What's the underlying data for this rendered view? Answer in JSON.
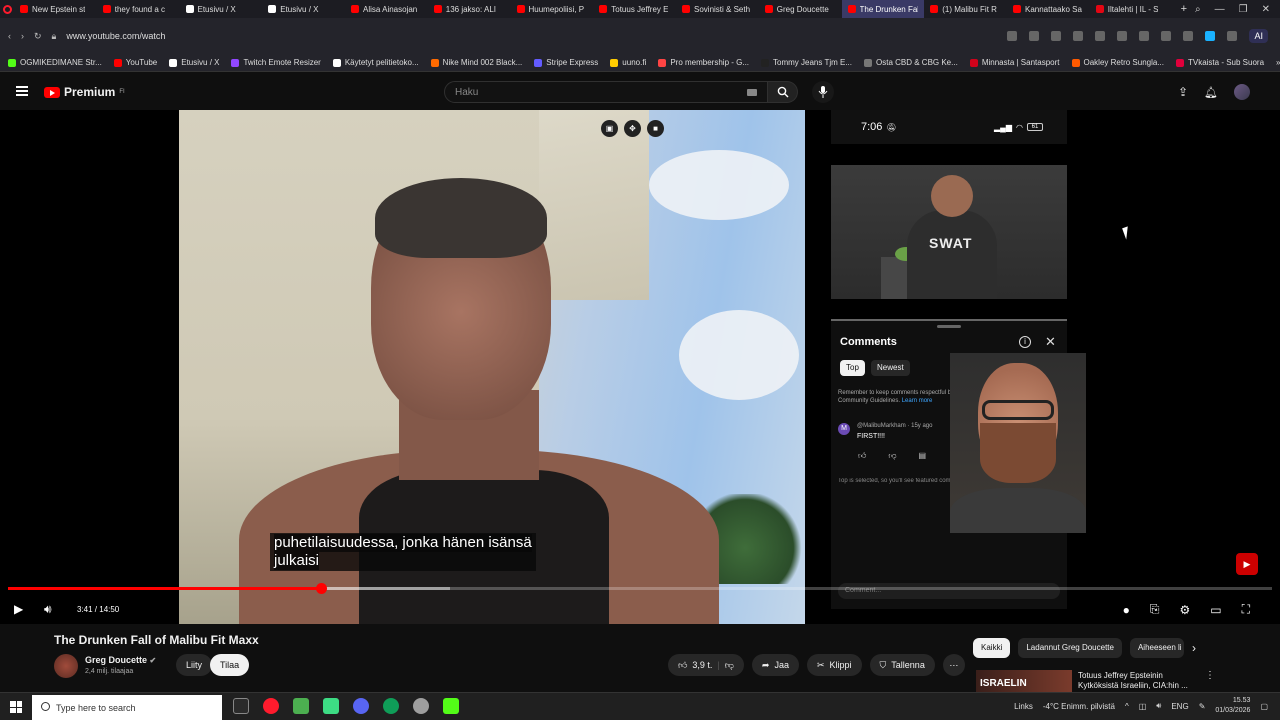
{
  "browser": {
    "tabs": [
      {
        "label": "New Epstein st",
        "color": "#ff0000"
      },
      {
        "label": "they found a c",
        "color": "#ff0000"
      },
      {
        "label": "Etusivu / X",
        "color": "#ffffff"
      },
      {
        "label": "Etusivu / X",
        "color": "#ffffff"
      },
      {
        "label": "Alisa Ainasojan",
        "color": "#ff0000"
      },
      {
        "label": "136 jakso: ALI",
        "color": "#ff0000"
      },
      {
        "label": "Huumepoliisi, P",
        "color": "#ff0000"
      },
      {
        "label": "Totuus Jeffrey E",
        "color": "#ff0000"
      },
      {
        "label": "Sovinisti & Seth",
        "color": "#ff0000"
      },
      {
        "label": "Greg Doucette",
        "color": "#ff0000"
      },
      {
        "label": "The Drunken Fall of Malib",
        "color": "#ff0000",
        "active": true
      },
      {
        "label": "(1) Malibu Fit R",
        "color": "#ff0000"
      },
      {
        "label": "Kannattaako Sa",
        "color": "#ff0000"
      },
      {
        "label": "Iltalehti | IL - S",
        "color": "#e30613"
      }
    ],
    "url": "www.youtube.com/watch",
    "ai_label": "AI",
    "bookmarks": [
      {
        "label": "OGMIKEDIMANE Str...",
        "color": "#53fc18"
      },
      {
        "label": "YouTube",
        "color": "#ff0000"
      },
      {
        "label": "Etusivu / X",
        "color": "#ffffff"
      },
      {
        "label": "Twitch Emote Resizer",
        "color": "#9147ff"
      },
      {
        "label": "Käytetyt pelitietoko...",
        "color": "#ffffff"
      },
      {
        "label": "Nike Mind 002 Black...",
        "color": "#ff6a00"
      },
      {
        "label": "Stripe Express",
        "color": "#635bff"
      },
      {
        "label": "uuno.fi",
        "color": "#ffcc00"
      },
      {
        "label": "Pro membership - G...",
        "color": "#ff4444"
      },
      {
        "label": "Tommy Jeans Tjm E...",
        "color": "#222222"
      },
      {
        "label": "Osta CBD & CBG Ke...",
        "color": "#777777"
      },
      {
        "label": "Minnasta | Santasport",
        "color": "#d0021b"
      },
      {
        "label": "Oakley Retro Sungla...",
        "color": "#ff5a00"
      },
      {
        "label": "TVkaista - Sub Suora",
        "color": "#e0003c"
      }
    ]
  },
  "yt": {
    "logo_text": "Premium",
    "logo_sup": "FI",
    "search_placeholder": "Haku"
  },
  "video": {
    "caption_line1": "puhetilaisuudessa, jonka hänen isänsä",
    "caption_line2": "julkaisi",
    "time": "3:41 / 14:50",
    "progress": 0.248,
    "buffered": 0.35
  },
  "overlay": {
    "phone_time": "7:06",
    "battery": "61",
    "shirt_text": "SWAT"
  },
  "comments": {
    "title": "Comments",
    "tab_top": "Top",
    "tab_newest": "Newest",
    "notice": "Remember to keep comments respectful by followi... Community Guidelines.",
    "notice_link": "Learn more",
    "user": "@MalibuMarkham · 15y ago",
    "user_initial": "M",
    "text": "FIRST!!!!",
    "footer": "Top is selected, so you'll see featured comment",
    "input_placeholder": "Comment..."
  },
  "meta": {
    "title": "The Drunken Fall of Malibu Fit Maxx",
    "channel": "Greg Doucette",
    "subs": "2,4 milj. tilaajaa",
    "join": "Liity",
    "subscribe": "Tilaa",
    "likes": "3,9 t.",
    "share": "Jaa",
    "clip": "Klippi",
    "save": "Tallenna",
    "chips": [
      "Kaikki",
      "Ladannut Greg Doucette",
      "Aiheeseen li"
    ],
    "rec_thumb_text": "ISRAELIN",
    "rec_title": "Totuus Jeffrey Epsteinin Kytköksistä Israeliin, CIA:hin ..."
  },
  "taskbar": {
    "search_placeholder": "Type here to search",
    "links": "Links",
    "weather": "-4°C  Enimm. pilvistä",
    "lang": "ENG",
    "time": "15.53",
    "date": "01/03/2026"
  }
}
